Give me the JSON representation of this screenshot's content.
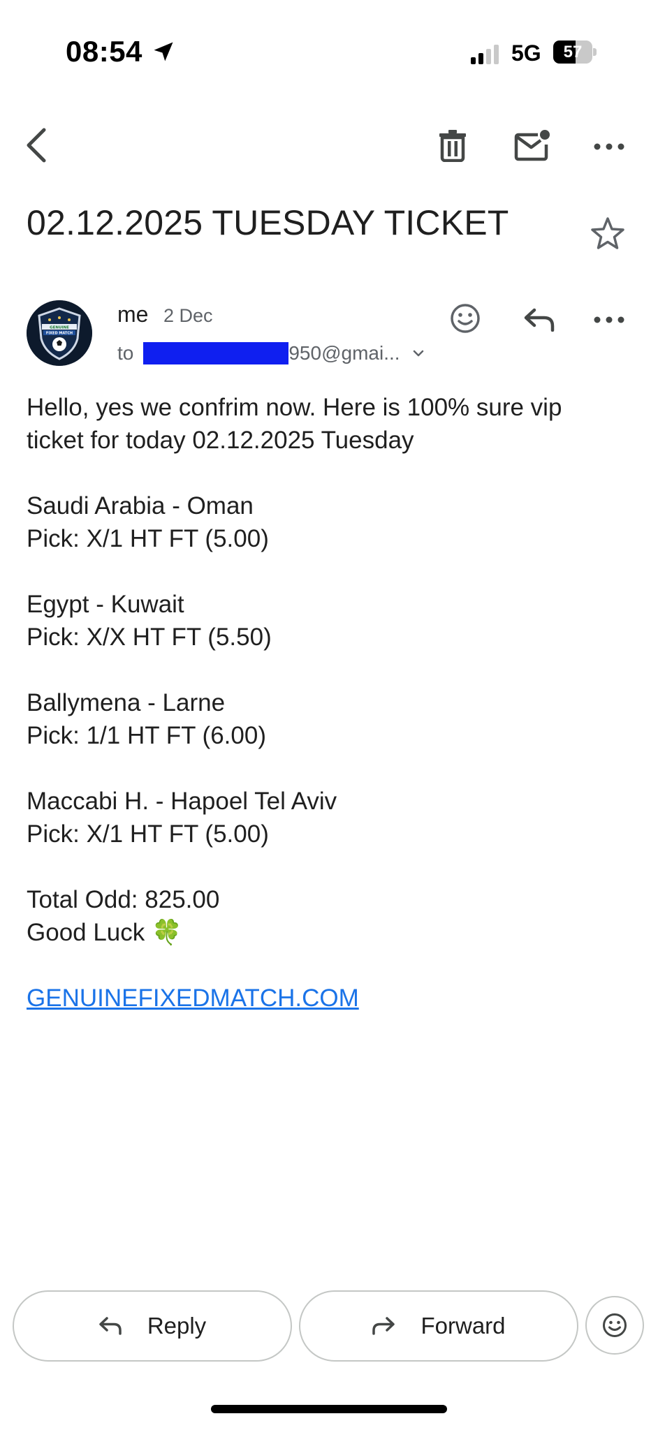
{
  "status_bar": {
    "time": "08:54",
    "network": "5G",
    "battery_percent": "57",
    "battery_level": 0.57,
    "signal_bars_active": 2,
    "signal_bars_total": 4
  },
  "toolbar": {
    "back_icon": "chevron-left-icon",
    "delete_icon": "trash-icon",
    "mark_unread_icon": "mail-unread-icon",
    "more_icon": "more-horizontal-icon"
  },
  "email": {
    "subject": "02.12.2025 TUESDAY TICKET",
    "sender": {
      "name": "me",
      "date": "2 Dec",
      "to_label": "to",
      "to_visible": "950@gmai..."
    },
    "body": {
      "intro_line1": "Hello, yes we confrim now. Here is 100% sure vip",
      "intro_line2": "ticket for today 02.12.2025 Tuesday",
      "matches": [
        {
          "teams": "Saudi Arabia - Oman",
          "pick": "Pick: X/1 HT FT (5.00)"
        },
        {
          "teams": "Egypt - Kuwait",
          "pick": "Pick: X/X HT FT (5.50)"
        },
        {
          "teams": "Ballymena - Larne",
          "pick": "Pick: 1/1 HT FT (6.00)"
        },
        {
          "teams": "Maccabi H. - Hapoel Tel Aviv",
          "pick": "Pick: X/1 HT FT (5.00)"
        }
      ],
      "total": "Total Odd: 825.00",
      "closing": "Good Luck 🍀",
      "link": "GENUINEFIXEDMATCH.COM"
    }
  },
  "avatar": {
    "badge_text_1": "GENUINE",
    "badge_text_2": "FIXED MATCH"
  },
  "actions": {
    "reply_label": "Reply",
    "forward_label": "Forward"
  },
  "colors": {
    "link": "#1a73e8",
    "redaction": "#0f1ff0",
    "icon": "#444746"
  }
}
